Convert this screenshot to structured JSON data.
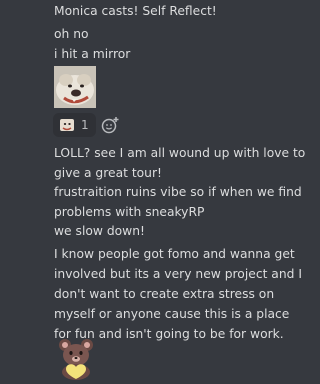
{
  "messages": [
    {
      "text": "Monica casts! Self Reflect!"
    },
    {
      "text": "oh no"
    },
    {
      "text": "i hit a mirror"
    },
    {
      "text": "LOLL? see I am all wound up with love to give a great tour!"
    },
    {
      "text": "frustraition ruins vibe so if when we find problems with sneakyRP"
    },
    {
      "text": "we slow down!"
    },
    {
      "text": "I know people got fomo and wanna get involved but its a very new project and I don't want to create extra stress on myself or anyone cause this is a place for fun and isn't going to be for work."
    }
  ],
  "reaction": {
    "emoji": "dog-emote-icon",
    "count": "1"
  },
  "add_reaction": {
    "icon": "add-reaction-icon"
  },
  "emotes": [
    {
      "name": "dog-face-emote"
    },
    {
      "name": "bear-hug-emote"
    }
  ],
  "colors": {
    "background": "#36393f",
    "text": "#dcddde",
    "reaction_bg": "#2f3136",
    "muted": "#b9bbbe"
  }
}
